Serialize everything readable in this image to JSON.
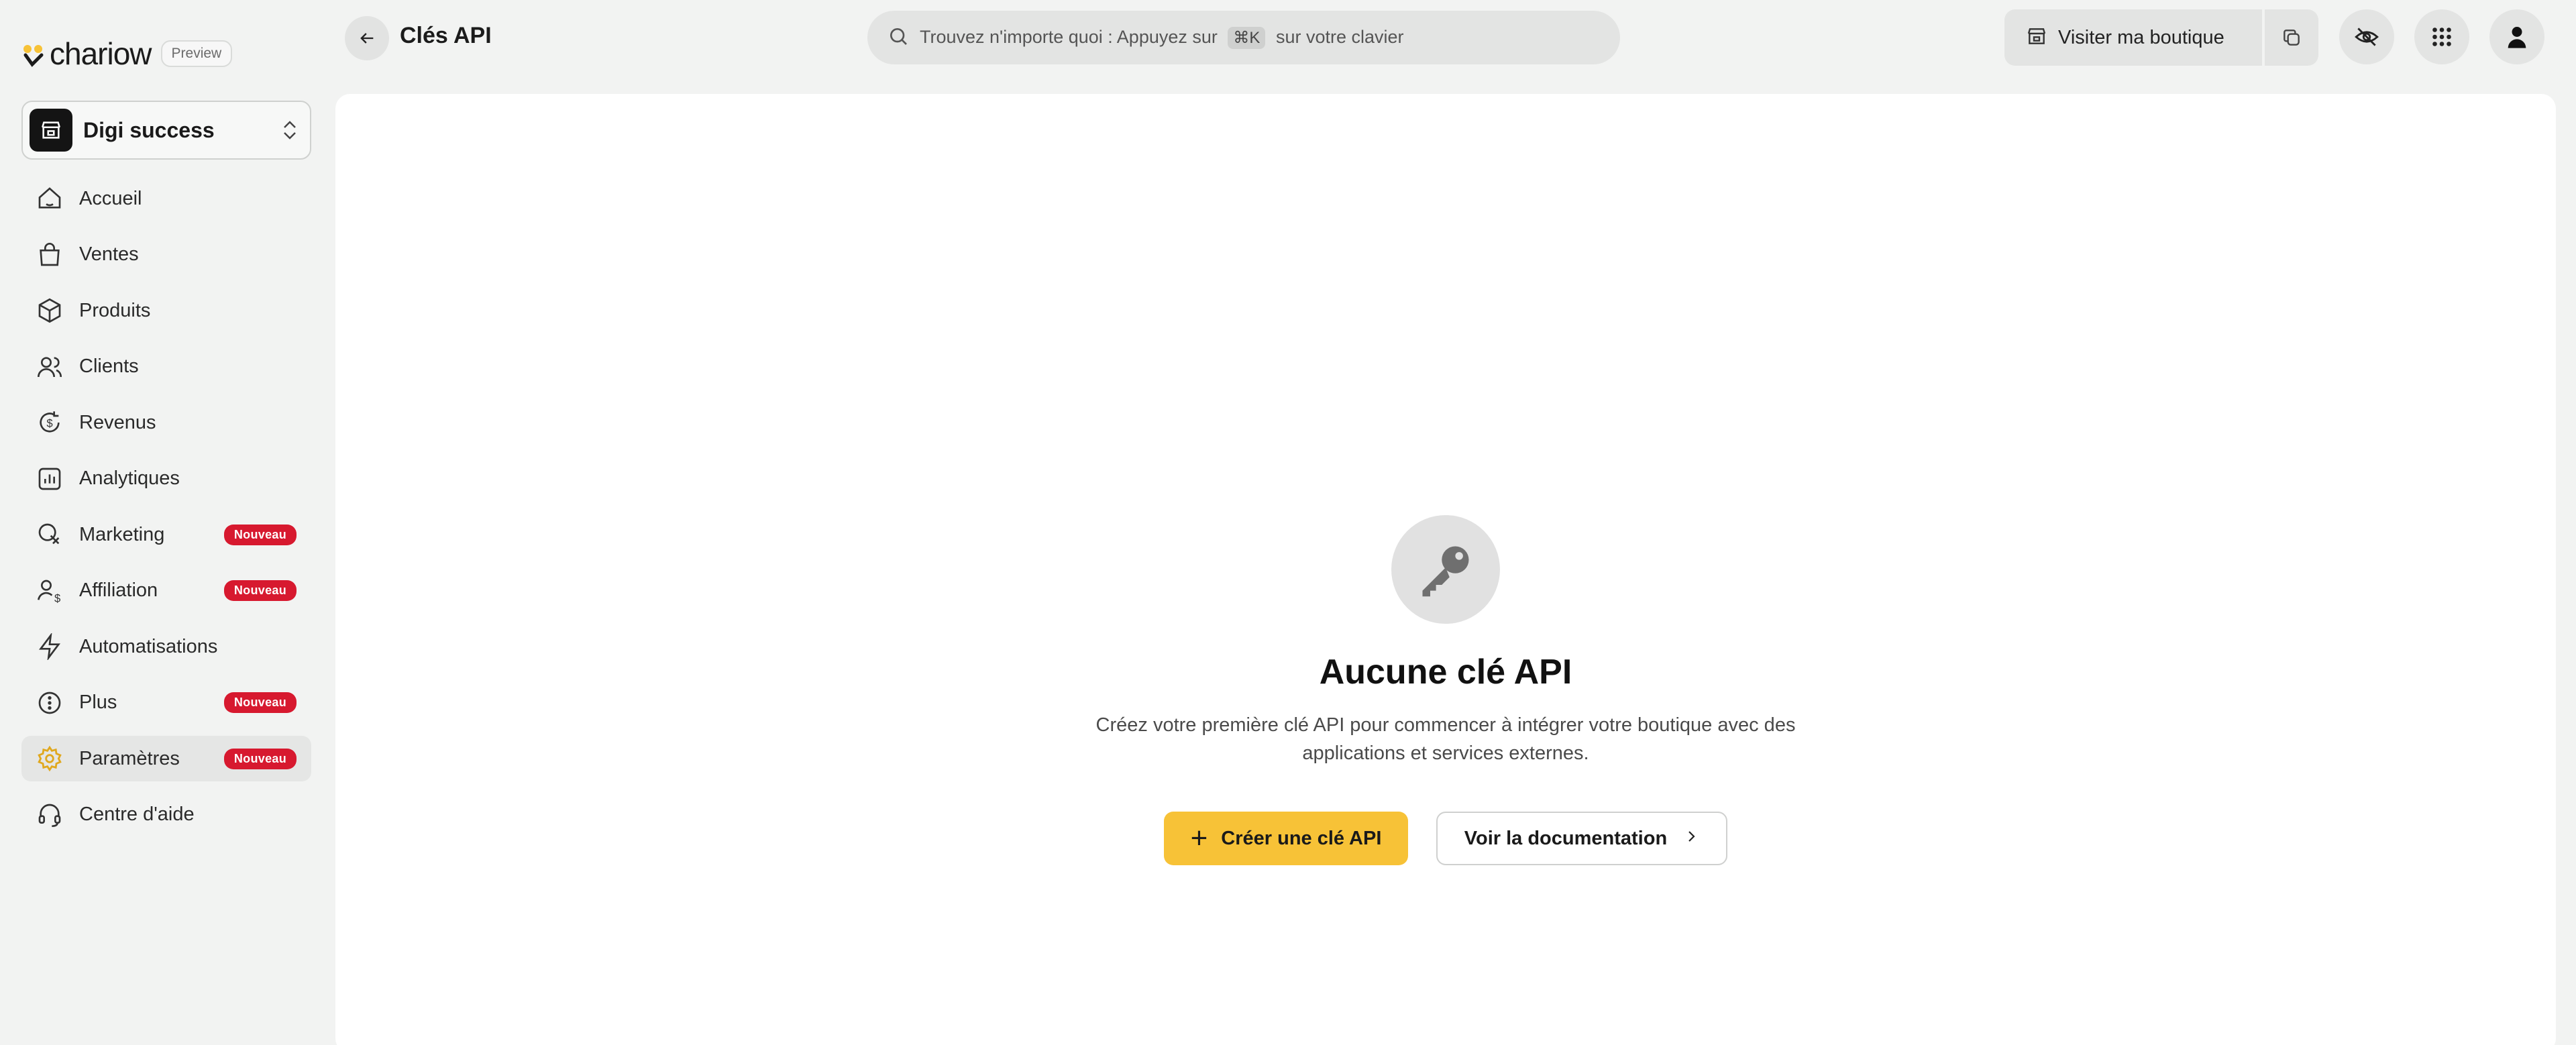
{
  "brand": {
    "name": "chariow",
    "preview": "Preview"
  },
  "workspace": {
    "name": "Digi success"
  },
  "sidebar": {
    "items": [
      {
        "label": "Accueil",
        "icon": "home-icon",
        "badge": ""
      },
      {
        "label": "Ventes",
        "icon": "shopping-bag-icon",
        "badge": ""
      },
      {
        "label": "Produits",
        "icon": "box-icon",
        "badge": ""
      },
      {
        "label": "Clients",
        "icon": "users-icon",
        "badge": ""
      },
      {
        "label": "Revenus",
        "icon": "dollar-refresh-icon",
        "badge": ""
      },
      {
        "label": "Analytiques",
        "icon": "bar-chart-icon",
        "badge": ""
      },
      {
        "label": "Marketing",
        "icon": "megaphone-icon",
        "badge": "Nouveau"
      },
      {
        "label": "Affiliation",
        "icon": "user-dollar-icon",
        "badge": "Nouveau"
      },
      {
        "label": "Automatisations",
        "icon": "lightning-icon",
        "badge": ""
      },
      {
        "label": "Plus",
        "icon": "more-circle-icon",
        "badge": "Nouveau"
      },
      {
        "label": "Paramètres",
        "icon": "gear-icon",
        "badge": "Nouveau",
        "active": true
      },
      {
        "label": "Centre d'aide",
        "icon": "headset-icon",
        "badge": ""
      }
    ]
  },
  "header": {
    "title": "Clés API",
    "search": {
      "before": "Trouvez n'importe quoi : Appuyez sur",
      "shortcut": "⌘K",
      "after": "sur votre clavier"
    },
    "visit_label": "Visiter ma boutique"
  },
  "empty_state": {
    "title": "Aucune clé API",
    "description_line1": "Créez votre première clé API pour commencer à intégrer votre boutique avec des",
    "description_line2": "applications et services externes.",
    "primary_button": "Créer une clé API",
    "secondary_button": "Voir la documentation"
  },
  "colors": {
    "accent": "#f7c237",
    "badge": "#d7192f",
    "active_icon": "#e0a81e"
  }
}
